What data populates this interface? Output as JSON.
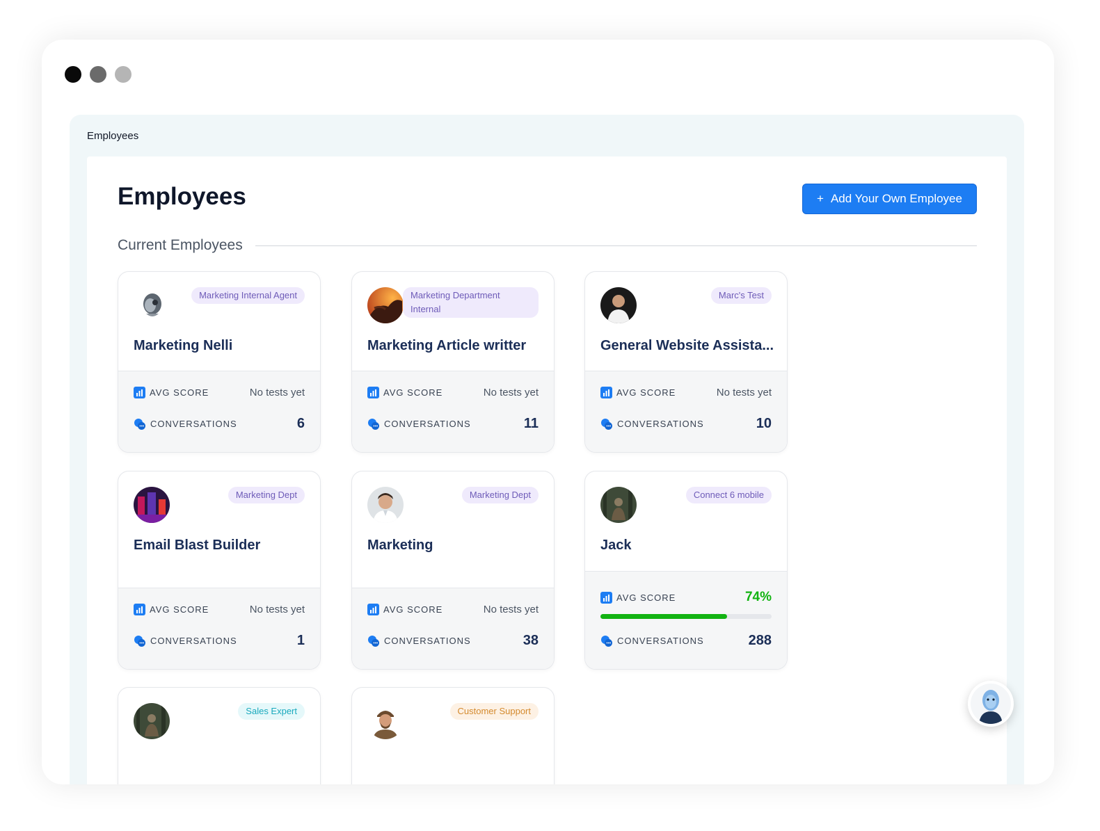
{
  "window_dots": [
    "#0a0a0a",
    "#6b6b6b",
    "#b5b5b5"
  ],
  "breadcrumb": "Employees",
  "page_title": "Employees",
  "add_button": {
    "icon": "plus-icon",
    "label": "Add Your Own Employee"
  },
  "section_label": "Current Employees",
  "metric_labels": {
    "avg_score": "AVG SCORE",
    "conversations": "CONVERSATIONS"
  },
  "employees": [
    {
      "name": "Marketing Nelli",
      "tag": "Marketing Internal Agent",
      "tag_color": "purple",
      "avatar": "robot-head-avatar",
      "avg_score": "No tests yet",
      "conversations": "6"
    },
    {
      "name": "Marketing Article writter",
      "tag": "Marketing Department Internal",
      "tag_color": "purple",
      "avatar": "dragon-sunset-avatar",
      "avg_score": "No tests yet",
      "conversations": "11"
    },
    {
      "name": "General Website Assista...",
      "tag": "Marc's Test",
      "tag_color": "purple",
      "avatar": "man-portrait-avatar",
      "avg_score": "No tests yet",
      "conversations": "10"
    },
    {
      "name": "Email Blast Builder",
      "tag": "Marketing Dept",
      "tag_color": "purple",
      "avatar": "neon-city-avatar",
      "avg_score": "No tests yet",
      "conversations": "1"
    },
    {
      "name": "Marketing",
      "tag": "Marketing Dept",
      "tag_color": "purple",
      "avatar": "businessman-avatar",
      "avg_score": "No tests yet",
      "conversations": "38"
    },
    {
      "name": "Jack",
      "tag": "Connect 6 mobile",
      "tag_color": "purple",
      "avatar": "forest-figure-avatar",
      "avg_score": "74%",
      "avg_score_fraction": 0.74,
      "conversations": "288"
    },
    {
      "tag": "Sales Expert",
      "tag_color": "cyan",
      "avatar": "forest-figure-avatar"
    },
    {
      "tag": "Customer Support",
      "tag_color": "orange",
      "avatar": "bearded-man-cap-avatar"
    }
  ],
  "colors": {
    "accent": "#1d7df3",
    "name": "#1b2e57",
    "success": "#12b312",
    "tag_purple": "#6e5bb8"
  },
  "assistant_fab": {
    "icon": "ai-assistant-avatar"
  }
}
